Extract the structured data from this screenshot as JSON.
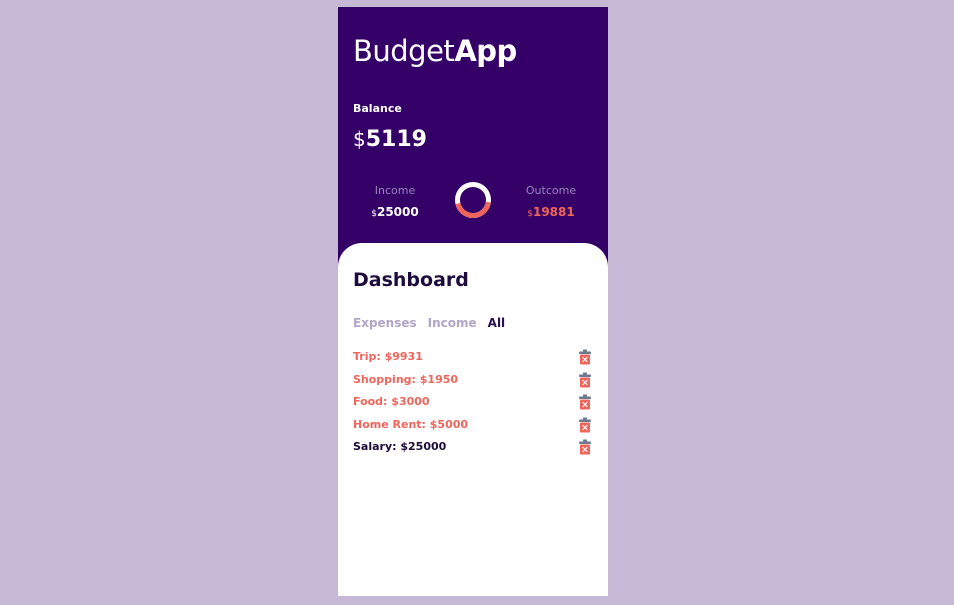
{
  "app": {
    "title_light": "Budget",
    "title_bold": "App"
  },
  "balance": {
    "label": "Balance",
    "currency": "$",
    "value": "5119"
  },
  "income": {
    "label": "Income",
    "currency": "$",
    "value": "25000"
  },
  "outcome": {
    "label": "Outcome",
    "currency": "$",
    "value": "19881"
  },
  "donut": {
    "income_color": "#ffffff",
    "outcome_color": "#f0655b",
    "outcome_fraction": 0.44
  },
  "dashboard": {
    "title": "Dashboard",
    "tabs": [
      {
        "label": "Expenses",
        "active": false
      },
      {
        "label": "Income",
        "active": false
      },
      {
        "label": "All",
        "active": true
      }
    ],
    "entries": [
      {
        "text": "Trip: $9931",
        "type": "expense"
      },
      {
        "text": "Shopping: $1950",
        "type": "expense"
      },
      {
        "text": "Food: $3000",
        "type": "expense"
      },
      {
        "text": "Home Rent: $5000",
        "type": "expense"
      },
      {
        "text": "Salary: $25000",
        "type": "income"
      }
    ],
    "delete_icon": "trash-icon"
  },
  "colors": {
    "page_background": "#c7b9d6",
    "header_background": "#340068",
    "accent": "#f0655b",
    "muted_tab": "#b0a6c6",
    "dark_text": "#1d0b3c"
  }
}
